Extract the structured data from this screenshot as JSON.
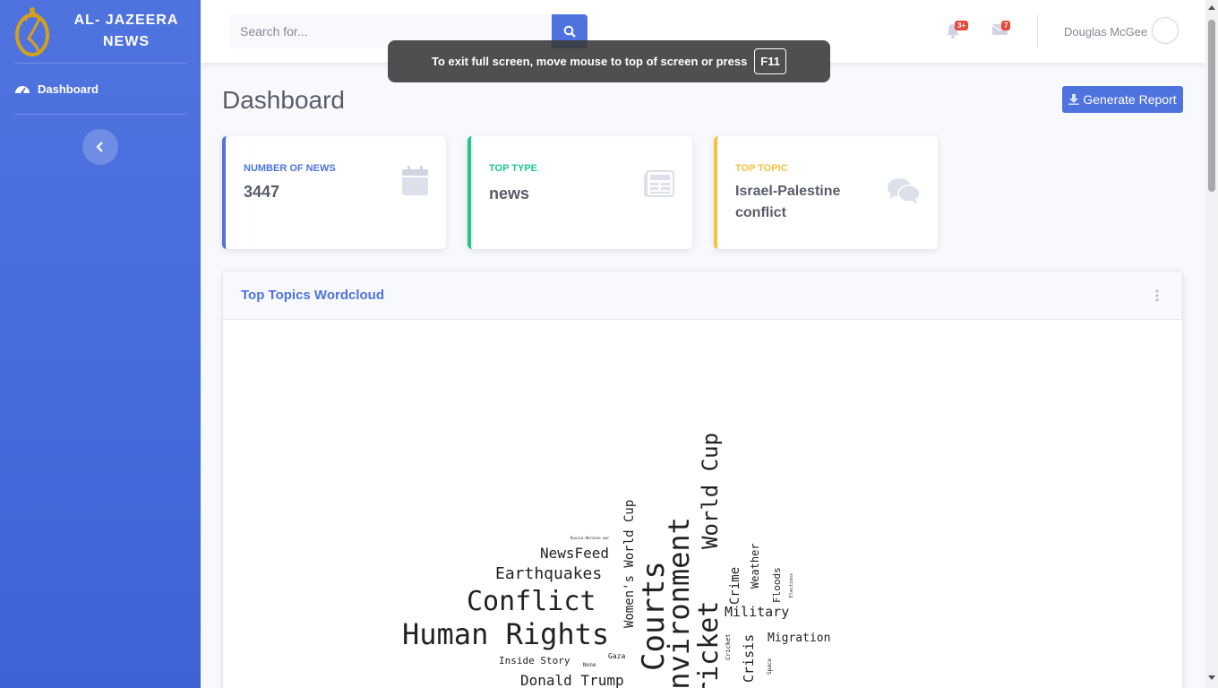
{
  "sidebar": {
    "brand": "AL- JAZEERA\nNEWS",
    "nav_items": [
      {
        "label": "Dashboard",
        "icon": "tachometer-icon"
      }
    ],
    "toggle_icon": "chevron-left-icon",
    "bg_color": "#4e73df"
  },
  "topbar": {
    "search_placeholder": "Search for...",
    "search_icon": "search-icon",
    "alerts_icon": "bell-icon",
    "alerts_count": "3+",
    "messages_icon": "envelope-icon",
    "messages_count": "7",
    "user_name": "Douglas McGee"
  },
  "fullscreen_notice": {
    "text": "To exit full screen, move mouse to top of screen or press",
    "key": "F11"
  },
  "main": {
    "page_title": "Dashboard",
    "report_button": "Generate Report",
    "report_icon": "download-icon",
    "cards": [
      {
        "label": "Number of News",
        "value": "3447",
        "color": "#4e73df",
        "icon": "calendar-icon"
      },
      {
        "label": "Top Type",
        "value": "news",
        "color": "#1cc88a",
        "icon": "newspaper-icon"
      },
      {
        "label": "Top Topic",
        "value": "Israel-Palestine conflict",
        "color": "#f6c23e",
        "icon": "comments-icon"
      }
    ],
    "wordcloud": {
      "title": "Top Topics Wordcloud",
      "menu_icon": "ellipsis-vertical-icon",
      "words": [
        {
          "text": "Human Rights",
          "size": 32,
          "rotated": false
        },
        {
          "text": "Conflict",
          "size": 30,
          "rotated": false
        },
        {
          "text": "Courts",
          "size": 34,
          "rotated": true
        },
        {
          "text": "Environment",
          "size": 32,
          "rotated": true
        },
        {
          "text": "Cricket",
          "size": 30,
          "rotated": true
        },
        {
          "text": "World Cup",
          "size": 24,
          "rotated": true
        },
        {
          "text": "Earthquakes",
          "size": 18,
          "rotated": false
        },
        {
          "text": "NewsFeed",
          "size": 16,
          "rotated": false
        },
        {
          "text": "Women's World Cup",
          "size": 14,
          "rotated": true
        },
        {
          "text": "Military",
          "size": 15,
          "rotated": false
        },
        {
          "text": "Crime",
          "size": 14,
          "rotated": true
        },
        {
          "text": "Weather",
          "size": 12,
          "rotated": true
        },
        {
          "text": "Floods",
          "size": 11,
          "rotated": true
        },
        {
          "text": "Migration",
          "size": 13,
          "rotated": false
        },
        {
          "text": "Crisis",
          "size": 15,
          "rotated": true
        },
        {
          "text": "Donald Trump",
          "size": 16,
          "rotated": false
        },
        {
          "text": "Inside Story",
          "size": 11,
          "rotated": false
        },
        {
          "text": "Gaza",
          "size": 8,
          "rotated": false
        },
        {
          "text": "None",
          "size": 6,
          "rotated": false
        },
        {
          "text": "Cricket",
          "size": 7,
          "rotated": true
        },
        {
          "text": "Space",
          "size": 6,
          "rotated": true
        },
        {
          "text": "Elections",
          "size": 5,
          "rotated": true
        },
        {
          "text": "Russia-Ukraine war",
          "size": 4,
          "rotated": false
        }
      ]
    }
  }
}
